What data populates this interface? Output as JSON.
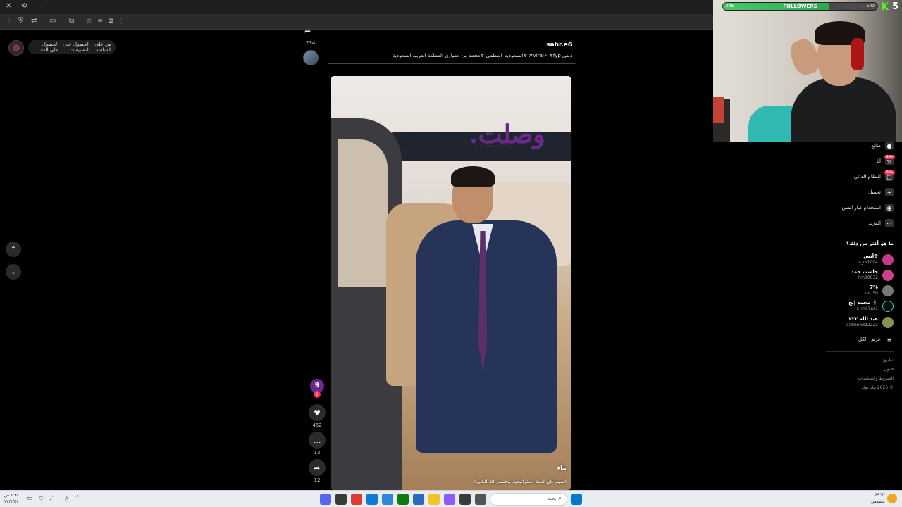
{
  "browser": {
    "title_controls": [
      "✕",
      "⟲",
      "—"
    ],
    "toolbar_icons": [
      "⋮",
      "⛨",
      "⇄",
      "▭",
      "⧉",
      "☆",
      "∞",
      "⧈",
      "▯"
    ]
  },
  "top_bar": {
    "pill_label": "من على الشاشة",
    "pill_download": "الحصول على التطبيقات",
    "pill_extra": "الحصول على الت..."
  },
  "nav": {
    "up": "⌃",
    "down": "⌄"
  },
  "post": {
    "username": "sahr.e6",
    "caption": "دبس Viral⚡ #fyp# #السعوديه_العظمى #محمد_بن_معيارن المملكة العربية السعودية",
    "share_count_top": "234",
    "video": {
      "brand": "وصلت.",
      "brand_sub": "ذكاء اصطناعي",
      "author": "ماء",
      "description": "المهم كان لديك استراتيجية بتختصر لك الكثير!"
    },
    "actions": {
      "avatar_letter": "9",
      "plus": "+",
      "like_icon": "♥",
      "like_count": "462",
      "comment_icon": "…",
      "comment_count": "13",
      "share_icon": "➦",
      "share_count": "12"
    }
  },
  "follow_goal": {
    "label": "FOLLOWERS",
    "current": "346",
    "goal": "500",
    "fraction": 0.69,
    "kick": "K",
    "kick_count": "5"
  },
  "sidebar": {
    "items": [
      {
        "label": "متابَع",
        "icon": "●"
      },
      {
        "label": "أنا",
        "icon": "▽",
        "badge": "99+"
      },
      {
        "label": "النظام الذاتي",
        "icon": "▢",
        "badge": "99+"
      },
      {
        "label": "تحميل",
        "icon": "+"
      },
      {
        "label": "استخدام كبار السن",
        "icon": "◉"
      },
      {
        "label": "المزيد",
        "icon": "⋯"
      }
    ],
    "suggested_heading": "ما هو أكثر من ذلك؟",
    "accounts": [
      {
        "name": "أنس✿",
        "handle": "a_m1004",
        "color": "#c53a8f"
      },
      {
        "name": "جاسث حمد",
        "handle": "hm00032",
        "color": "#d0418b"
      },
      {
        "name": "7%",
        "handle": "ns.l50",
        "color": "#777777"
      },
      {
        "name": "محمد إنج 🧍",
        "handle": "x_mo7as1",
        "color": "#0d0d0d"
      },
      {
        "name": "عبد الله ٢٢٢",
        "handle": "aabboodd2222",
        "color": "#8a8f55"
      }
    ],
    "see_all": "عرض الكل",
    "footer": [
      "تطبيق",
      "قانون",
      "الشروط والسياسات",
      "© 2026 تيك توك"
    ]
  },
  "taskbar": {
    "time": "١:٣٨ ص",
    "date": "٢٧/٧/٤١",
    "search_label": "بحث",
    "weather_temp": "25°C",
    "weather_desc": "مشمس"
  }
}
